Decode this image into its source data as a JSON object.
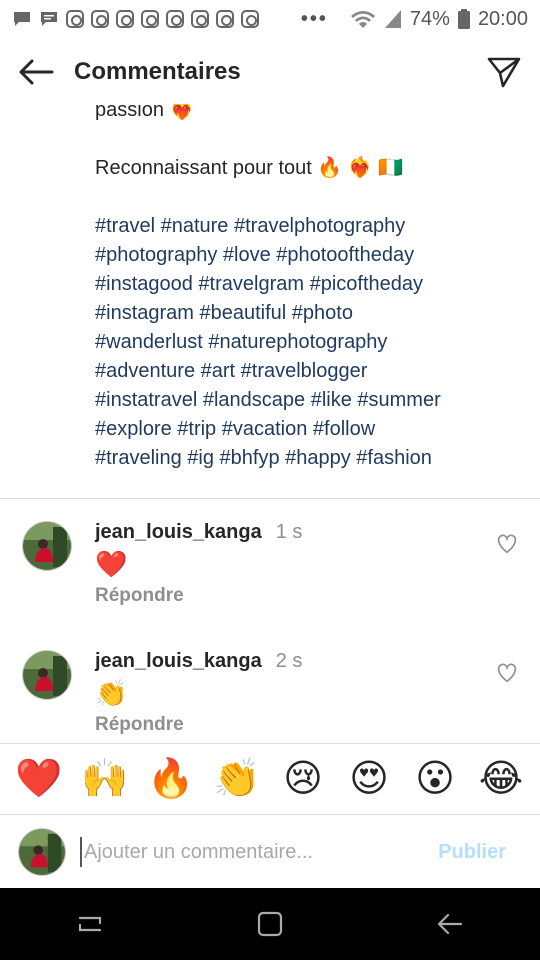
{
  "status_bar": {
    "battery": "74%",
    "time": "20:00",
    "more": "•••",
    "notification_icons": [
      "chat-icon",
      "chat-icon",
      "instagram-icon",
      "instagram-icon",
      "instagram-icon",
      "instagram-icon",
      "instagram-icon",
      "instagram-icon",
      "instagram-icon",
      "instagram-icon"
    ]
  },
  "header": {
    "title": "Commentaires"
  },
  "caption": {
    "lines_top": [
      "passion ❤️‍🔥"
    ],
    "line_thanks": "Reconnaissant pour tout 🔥 ❤️‍🔥 🇨🇮",
    "hashtag_lines": [
      "#travel #nature #travelphotography",
      "#photography #love #photooftheday",
      "#instagood #travelgram #picoftheday",
      "#instagram #beautiful #photo",
      "#wanderlust #naturephotography",
      "#adventure #art #travelblogger",
      "#instatravel #landscape #like #summer",
      "#explore #trip #vacation #follow",
      "#traveling #ig #bhfyp #happy #fashion"
    ]
  },
  "comments": [
    {
      "username": "jean_louis_kanga",
      "time": "1 s",
      "body": "❤️",
      "reply_label": "Répondre"
    },
    {
      "username": "jean_louis_kanga",
      "time": "2 s",
      "body": "👏",
      "reply_label": "Répondre"
    }
  ],
  "emoji_bar": [
    "❤️",
    "🙌",
    "🔥",
    "👏",
    "😢",
    "😍",
    "😮",
    "😂"
  ],
  "input": {
    "placeholder": "Ajouter un commentaire...",
    "value": "",
    "publish_label": "Publier"
  },
  "colors": {
    "hashtag": "#1e3a5f",
    "publish_disabled": "#b2dffc",
    "secondary_text": "#8e8e8e",
    "divider": "#dbdbdb"
  }
}
